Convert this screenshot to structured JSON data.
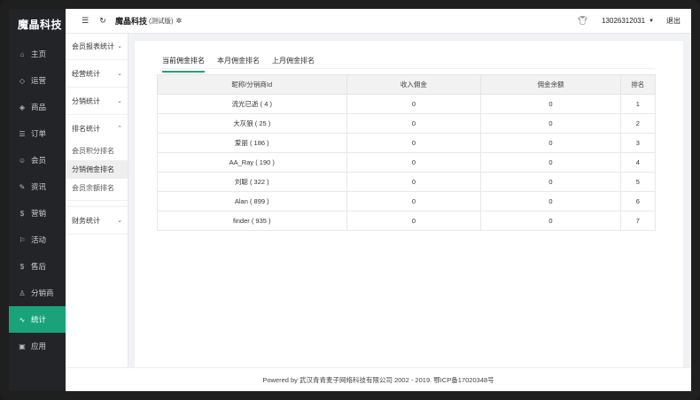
{
  "nav": {
    "brand": "魔晶科技",
    "items": [
      {
        "label": "主页",
        "icon": "home-icon",
        "glyph": "⌂"
      },
      {
        "label": "运营",
        "icon": "shield-icon",
        "glyph": "◇"
      },
      {
        "label": "商品",
        "icon": "tag-icon",
        "glyph": "◈"
      },
      {
        "label": "订单",
        "icon": "list-icon",
        "glyph": "☰"
      },
      {
        "label": "会员",
        "icon": "smile-icon",
        "glyph": "☺"
      },
      {
        "label": "资讯",
        "icon": "edit-icon",
        "glyph": "✎"
      },
      {
        "label": "营销",
        "icon": "dollar-icon",
        "glyph": "$"
      },
      {
        "label": "活动",
        "icon": "flag-icon",
        "glyph": "⚐"
      },
      {
        "label": "售后",
        "icon": "dollar-circle-icon",
        "glyph": "$"
      },
      {
        "label": "分销商",
        "icon": "user-icon",
        "glyph": "♙"
      },
      {
        "label": "统计",
        "icon": "pulse-icon",
        "glyph": "∿"
      },
      {
        "label": "应用",
        "icon": "apps-icon",
        "glyph": "▣"
      }
    ],
    "active_index": 10
  },
  "subnav": {
    "group_report": "会员报表统计",
    "group_business": "经营统计",
    "group_distribution": "分销统计",
    "group_ranking": "排名统计",
    "ranking_items": [
      "会员积分排名",
      "分销佣金排名",
      "会员余额排名"
    ],
    "group_finance": "财务统计"
  },
  "header": {
    "title": "魔晶科技",
    "badge": "(测试版)",
    "user": "13026312031",
    "logout": "退出"
  },
  "tabs": [
    "当前佣金排名",
    "本月佣金排名",
    "上月佣金排名"
  ],
  "table": {
    "headers": [
      "昵称/分销商Id",
      "收入佣金",
      "佣金余额",
      "排名"
    ],
    "rows": [
      [
        "流光已逝 ( 4 )",
        "0",
        "0",
        "1"
      ],
      [
        "大灰狼 ( 25 )",
        "0",
        "0",
        "2"
      ],
      [
        "爱丽 ( 186 )",
        "0",
        "0",
        "3"
      ],
      [
        "AA_Ray ( 190 )",
        "0",
        "0",
        "4"
      ],
      [
        "刘聪 ( 322 )",
        "0",
        "0",
        "5"
      ],
      [
        "Alan ( 899 )",
        "0",
        "0",
        "6"
      ],
      [
        "finder ( 935 )",
        "0",
        "0",
        "7"
      ]
    ]
  },
  "footer": "Powered by 武汉青青麦子网络科技有限公司 2002 - 2019. 鄂ICP备17020348号",
  "colors": {
    "accent": "#1aa37a",
    "nav_bg": "#222428"
  }
}
